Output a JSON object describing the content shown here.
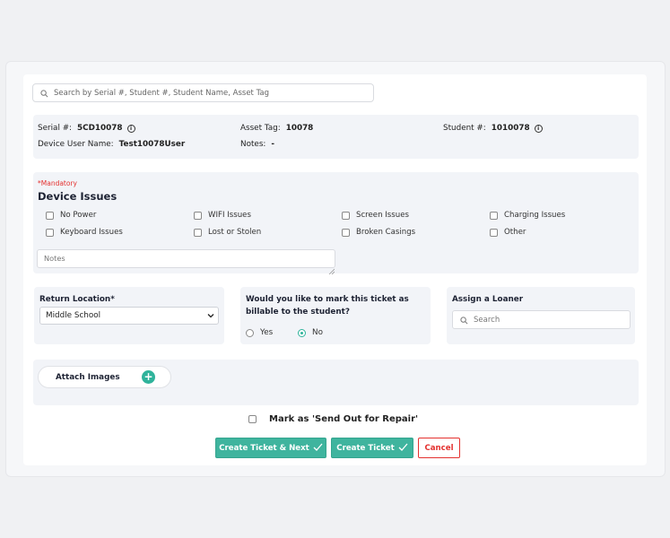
{
  "search": {
    "placeholder": "Search by Serial #, Student #, Student Name, Asset Tag"
  },
  "device_info": {
    "serial_label": "Serial #:",
    "serial_value": "5CD10078",
    "asset_tag_label": "Asset Tag:",
    "asset_tag_value": "10078",
    "student_label": "Student #:",
    "student_value": "1010078",
    "user_name_label": "Device User Name:",
    "user_name_value": "Test10078User",
    "notes_label": "Notes:",
    "notes_value": "-"
  },
  "issues": {
    "mandatory": "*Mandatory",
    "title": "Device Issues",
    "options": [
      "No Power",
      "WIFI Issues",
      "Screen Issues",
      "Charging Issues",
      "Keyboard Issues",
      "Lost or Stolen",
      "Broken Casings",
      "Other"
    ],
    "notes_placeholder": "Notes"
  },
  "return_location": {
    "label": "Return Location*",
    "selected": "Middle School"
  },
  "billable": {
    "question": "Would you like to mark this ticket as billable to the student?",
    "options": [
      "Yes",
      "No"
    ],
    "selected": "No"
  },
  "loaner": {
    "label": "Assign a Loaner",
    "placeholder": "Search"
  },
  "attach": {
    "label": "Attach Images",
    "plus": "+"
  },
  "repair": {
    "label": "Mark as 'Send Out for Repair'"
  },
  "buttons": {
    "create_next": "Create Ticket & Next",
    "create": "Create Ticket",
    "cancel": "Cancel"
  },
  "colors": {
    "accent": "#3fb49e",
    "danger": "#e4312f",
    "panel": "#f2f4f8"
  }
}
